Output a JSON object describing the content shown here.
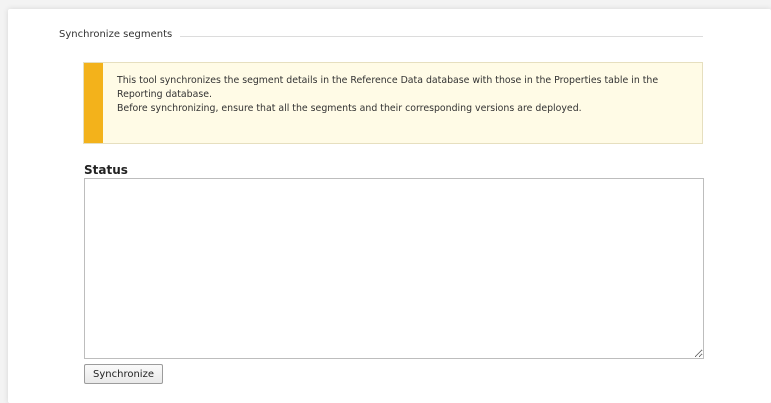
{
  "section": {
    "title": "Synchronize segments"
  },
  "notice": {
    "line1": "This tool synchronizes the segment details in the Reference Data database with those in the Properties table in the Reporting database.",
    "line2": "Before synchronizing, ensure that all the segments and their corresponding versions are deployed.",
    "accent_color": "#f3b21b",
    "background_color": "#fffbe6"
  },
  "status": {
    "label": "Status",
    "value": ""
  },
  "actions": {
    "synchronize_label": "Synchronize"
  }
}
